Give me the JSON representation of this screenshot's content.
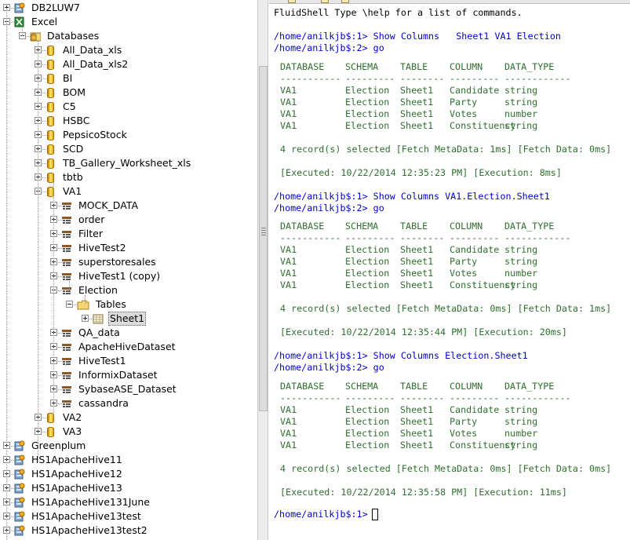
{
  "tree": {
    "connections": {
      "db2": "DB2LUW7",
      "excel": "Excel",
      "greenplum": "Greenplum",
      "hs1_11": "HS1ApacheHive11",
      "hs1_12": "HS1ApacheHive12",
      "hs1_13": "HS1ApacheHive13",
      "hs1_131june": "HS1ApacheHive131June",
      "hs1_13test": "HS1ApacheHive13test",
      "hs1_13test2": "HS1ApacheHive13test2"
    },
    "databases_label": "Databases",
    "databases": [
      "All_Data_xls",
      "All_Data_xls2",
      "BI",
      "BOM",
      "C5",
      "HSBC",
      "PepsicoStock",
      "SCD",
      "TB_Gallery_Worksheet_xls",
      "tbtb",
      "VA1"
    ],
    "va1_children": [
      "MOCK_DATA",
      "order",
      "Filter",
      "HiveTest2",
      "superstoresales",
      "HiveTest1 (copy)",
      "Election"
    ],
    "election_tables_label": "Tables",
    "election_sheet": "Sheet1",
    "va1_children_after": [
      "QA_data",
      "ApacheHiveDataset",
      "HiveTest1",
      "InformixDataset",
      "SybaseASE_Dataset",
      "cassandra"
    ],
    "databases_after": [
      "VA2",
      "VA3"
    ]
  },
  "console": {
    "intro": "FluidShell Type \\help for a list of commands.",
    "blocks": [
      {
        "cmd1": "/home/anilkjb$:1> Show Columns   Sheet1 VA1 Election",
        "cmd2": "/home/anilkjb$:2> go",
        "headers": [
          "DATABASE",
          "SCHEMA",
          "TABLE",
          "COLUMN",
          "DATA_TYPE"
        ],
        "rows": [
          [
            "VA1",
            "Election",
            "Sheet1",
            "Candidate",
            "string"
          ],
          [
            "VA1",
            "Election",
            "Sheet1",
            "Party",
            "string"
          ],
          [
            "VA1",
            "Election",
            "Sheet1",
            "Votes",
            "number"
          ],
          [
            "VA1",
            "Election",
            "Sheet1",
            "Constituency",
            "string"
          ]
        ],
        "summary": "4 record(s) selected [Fetch MetaData: 1ms] [Fetch Data: 0ms]",
        "executed": "[Executed: 10/22/2014 12:35:23 PM] [Execution: 8ms]"
      },
      {
        "cmd1": "/home/anilkjb$:1> Show Columns VA1.Election.Sheet1",
        "cmd2": "/home/anilkjb$:2> go",
        "headers": [
          "DATABASE",
          "SCHEMA",
          "TABLE",
          "COLUMN",
          "DATA_TYPE"
        ],
        "rows": [
          [
            "VA1",
            "Election",
            "Sheet1",
            "Candidate",
            "string"
          ],
          [
            "VA1",
            "Election",
            "Sheet1",
            "Party",
            "string"
          ],
          [
            "VA1",
            "Election",
            "Sheet1",
            "Votes",
            "number"
          ],
          [
            "VA1",
            "Election",
            "Sheet1",
            "Constituency",
            "string"
          ]
        ],
        "summary": "4 record(s) selected [Fetch MetaData: 0ms] [Fetch Data: 1ms]",
        "executed": "[Executed: 10/22/2014 12:35:44 PM] [Execution: 20ms]"
      },
      {
        "cmd1": "/home/anilkjb$:1> Show Columns Election.Sheet1",
        "cmd2": "/home/anilkjb$:2> go",
        "headers": [
          "DATABASE",
          "SCHEMA",
          "TABLE",
          "COLUMN",
          "DATA_TYPE"
        ],
        "rows": [
          [
            "VA1",
            "Election",
            "Sheet1",
            "Candidate",
            "string"
          ],
          [
            "VA1",
            "Election",
            "Sheet1",
            "Party",
            "string"
          ],
          [
            "VA1",
            "Election",
            "Sheet1",
            "Votes",
            "number"
          ],
          [
            "VA1",
            "Election",
            "Sheet1",
            "Constituency",
            "string"
          ]
        ],
        "summary": "4 record(s) selected [Fetch MetaData: 0ms] [Fetch Data: 0ms]",
        "executed": "[Executed: 10/22/2014 12:35:58 PM] [Execution: 11ms]"
      }
    ],
    "prompt": "/home/anilkjb$:1> ",
    "colors": {
      "prompt": "#0000c8",
      "output": "#2f6f2f",
      "text": "#000000"
    }
  }
}
